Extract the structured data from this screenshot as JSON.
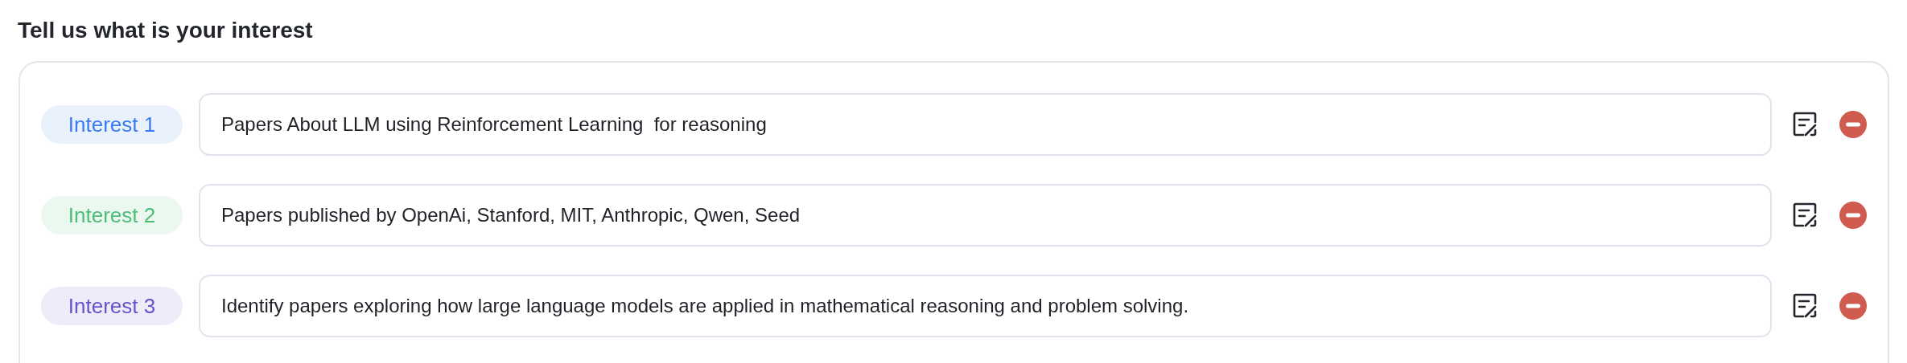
{
  "title": "Tell us what is your interest",
  "interests": [
    {
      "label": "Interest 1",
      "color": "#3b7bf0",
      "value": "Papers About LLM using Reinforcement Learning  for reasoning"
    },
    {
      "label": "Interest 2",
      "color": "#4dbd78",
      "value": "Papers published by OpenAi, Stanford, MIT, Anthropic, Qwen, Seed"
    },
    {
      "label": "Interest 3",
      "color": "#6a52cc",
      "value": "Identify papers exploring how large language models are applied in mathematical reasoning and problem solving."
    }
  ]
}
